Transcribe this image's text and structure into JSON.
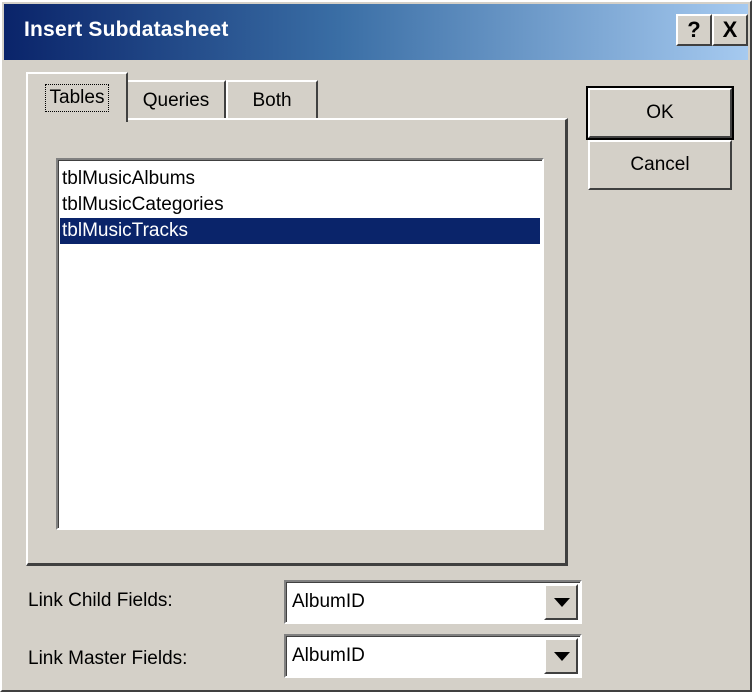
{
  "window": {
    "title": "Insert Subdatasheet",
    "help_button": "?",
    "close_button": "X"
  },
  "tabs": [
    {
      "label": "Tables",
      "active": true
    },
    {
      "label": "Queries",
      "active": false
    },
    {
      "label": "Both",
      "active": false
    }
  ],
  "list": {
    "items": [
      {
        "label": "tblMusicAlbums",
        "selected": false
      },
      {
        "label": "tblMusicCategories",
        "selected": false
      },
      {
        "label": "tblMusicTracks",
        "selected": true
      }
    ]
  },
  "buttons": {
    "ok": "OK",
    "cancel": "Cancel"
  },
  "fields": {
    "child_label": "Link Child Fields:",
    "child_value": "AlbumID",
    "master_label": "Link Master Fields:",
    "master_value": "AlbumID"
  },
  "colors": {
    "dialog_face": "#d4d0c8",
    "title_gradient_start": "#0a246a",
    "title_gradient_end": "#a6caf0",
    "selection": "#0a246a"
  }
}
